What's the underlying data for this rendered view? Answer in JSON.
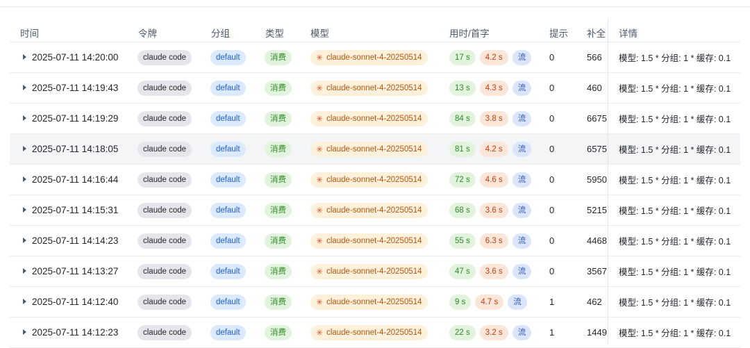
{
  "headers": {
    "time": "时间",
    "token": "令牌",
    "group": "分组",
    "type": "类型",
    "model": "模型",
    "duration": "用时/首字",
    "prompt": "提示",
    "completion": "补全",
    "detail": "详情"
  },
  "rows": [
    {
      "time": "2025-07-11 14:20:00",
      "token": "claude code",
      "group": "default",
      "type": "消费",
      "model": "claude-sonnet-4-20250514",
      "use": "17 s",
      "first": "4.2 s",
      "stream": "流",
      "prompt": "0",
      "completion": "566",
      "detail": "模型: 1.5 * 分组: 1 * 缓存: 0.1"
    },
    {
      "time": "2025-07-11 14:19:43",
      "token": "claude code",
      "group": "default",
      "type": "消费",
      "model": "claude-sonnet-4-20250514",
      "use": "13 s",
      "first": "4.3 s",
      "stream": "流",
      "prompt": "0",
      "completion": "460",
      "detail": "模型: 1.5 * 分组: 1 * 缓存: 0.1"
    },
    {
      "time": "2025-07-11 14:19:29",
      "token": "claude code",
      "group": "default",
      "type": "消费",
      "model": "claude-sonnet-4-20250514",
      "use": "84 s",
      "first": "3.8 s",
      "stream": "流",
      "prompt": "0",
      "completion": "6675",
      "detail": "模型: 1.5 * 分组: 1 * 缓存: 0.1"
    },
    {
      "time": "2025-07-11 14:18:05",
      "token": "claude code",
      "group": "default",
      "type": "消费",
      "model": "claude-sonnet-4-20250514",
      "use": "81 s",
      "first": "4.2 s",
      "stream": "流",
      "prompt": "0",
      "completion": "6575",
      "detail": "模型: 1.5 * 分组: 1 * 缓存: 0.1"
    },
    {
      "time": "2025-07-11 14:16:44",
      "token": "claude code",
      "group": "default",
      "type": "消费",
      "model": "claude-sonnet-4-20250514",
      "use": "72 s",
      "first": "4.6 s",
      "stream": "流",
      "prompt": "0",
      "completion": "5950",
      "detail": "模型: 1.5 * 分组: 1 * 缓存: 0.1"
    },
    {
      "time": "2025-07-11 14:15:31",
      "token": "claude code",
      "group": "default",
      "type": "消费",
      "model": "claude-sonnet-4-20250514",
      "use": "68 s",
      "first": "3.6 s",
      "stream": "流",
      "prompt": "0",
      "completion": "5215",
      "detail": "模型: 1.5 * 分组: 1 * 缓存: 0.1"
    },
    {
      "time": "2025-07-11 14:14:23",
      "token": "claude code",
      "group": "default",
      "type": "消费",
      "model": "claude-sonnet-4-20250514",
      "use": "55 s",
      "first": "6.3 s",
      "stream": "流",
      "prompt": "0",
      "completion": "4468",
      "detail": "模型: 1.5 * 分组: 1 * 缓存: 0.1"
    },
    {
      "time": "2025-07-11 14:13:27",
      "token": "claude code",
      "group": "default",
      "type": "消费",
      "model": "claude-sonnet-4-20250514",
      "use": "47 s",
      "first": "3.6 s",
      "stream": "流",
      "prompt": "0",
      "completion": "3567",
      "detail": "模型: 1.5 * 分组: 1 * 缓存: 0.1"
    },
    {
      "time": "2025-07-11 14:12:40",
      "token": "claude code",
      "group": "default",
      "type": "消费",
      "model": "claude-sonnet-4-20250514",
      "use": "9 s",
      "first": "4.7 s",
      "stream": "流",
      "prompt": "1",
      "completion": "462",
      "detail": "模型: 1.5 * 分组: 1 * 缓存: 0.1"
    },
    {
      "time": "2025-07-11 14:12:23",
      "token": "claude code",
      "group": "default",
      "type": "消费",
      "model": "claude-sonnet-4-20250514",
      "use": "22 s",
      "first": "3.2 s",
      "stream": "流",
      "prompt": "1",
      "completion": "1449",
      "detail": "模型: 1.5 * 分组: 1 * 缓存: 0.1"
    }
  ],
  "icons": {
    "expand": "caret-right-icon",
    "model": "claude-star-icon"
  },
  "colors": {
    "green": "#2c8a23",
    "orange": "#c2410c",
    "blue": "#2f56c6",
    "model": "#b3560f"
  }
}
